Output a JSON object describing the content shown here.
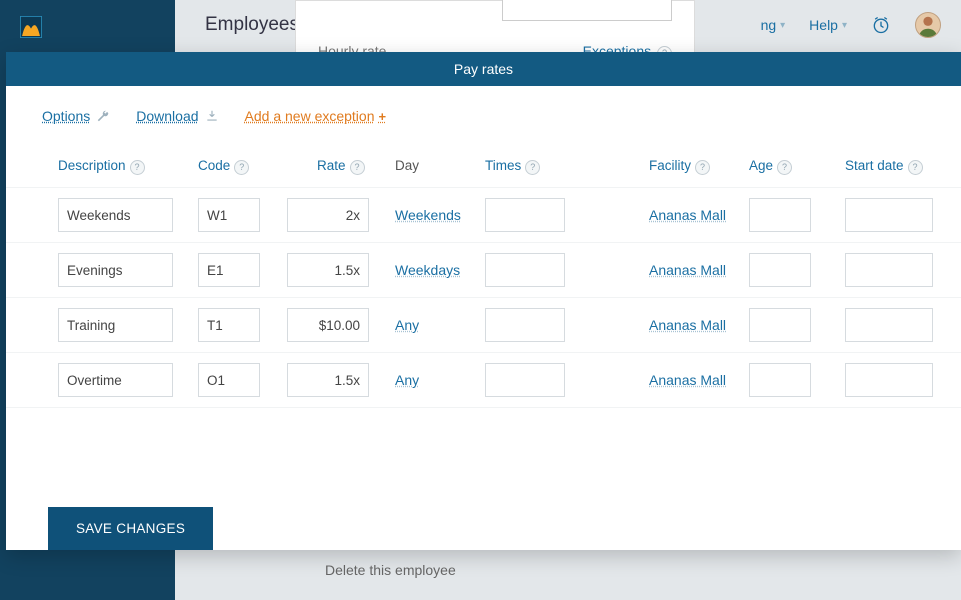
{
  "bg": {
    "page_title": "Employees",
    "help_label": "Help",
    "hourly_rate_label": "Hourly rate",
    "exceptions_label": "Exceptions",
    "delete_label": "Delete this employee",
    "truncated_nav": "ng"
  },
  "modal": {
    "title": "Pay rates",
    "toolbar": {
      "options": "Options",
      "download": "Download",
      "add_exception": "Add a new exception"
    },
    "headers": {
      "description": "Description",
      "code": "Code",
      "rate": "Rate",
      "day": "Day",
      "times": "Times",
      "facility": "Facility",
      "age": "Age",
      "start_date": "Start date"
    },
    "rows": [
      {
        "description": "Weekends",
        "code": "W1",
        "rate": "2x",
        "day": "Weekends",
        "times": "",
        "facility": "Ananas Mall",
        "age": "",
        "start": ""
      },
      {
        "description": "Evenings",
        "code": "E1",
        "rate": "1.5x",
        "day": "Weekdays",
        "times": "",
        "facility": "Ananas Mall",
        "age": "",
        "start": ""
      },
      {
        "description": "Training",
        "code": "T1",
        "rate": "$10.00",
        "day": "Any",
        "times": "",
        "facility": "Ananas Mall",
        "age": "",
        "start": ""
      },
      {
        "description": "Overtime",
        "code": "O1",
        "rate": "1.5x",
        "day": "Any",
        "times": "",
        "facility": "Ananas Mall",
        "age": "",
        "start": ""
      }
    ],
    "save_label": "SAVE CHANGES"
  }
}
